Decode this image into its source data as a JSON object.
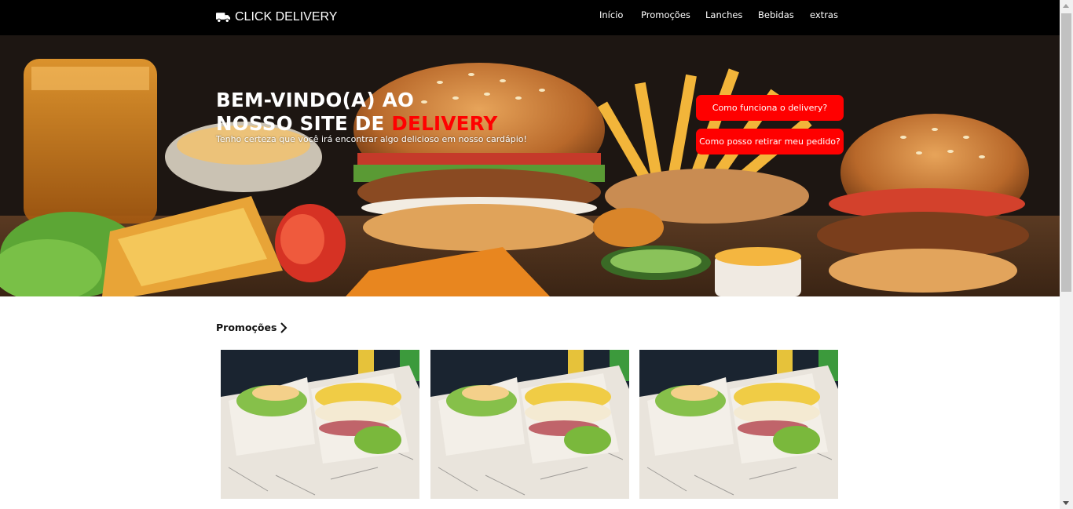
{
  "navbar": {
    "brand": "CLICK DELIVERY",
    "brand_icon": "truck-icon",
    "links": [
      "Início",
      "Promoções",
      "Lanches",
      "Bebidas",
      "extras"
    ]
  },
  "hero": {
    "title_line1": "BEM-VINDO(A) AO",
    "title_line2_prefix": "NOSSO SITE DE ",
    "title_line2_accent": "DELIVERY",
    "subtitle": "Tenho certeza que você irá encontrar algo delicioso em nosso cardápio!",
    "buttons": [
      "Como funciona o delivery?",
      "Como posso retirar meu pedido?"
    ]
  },
  "promotions": {
    "title": "Promoções",
    "title_icon": "chevron-right-icon",
    "cards": [
      {
        "image": "sandwich-combo-photo"
      },
      {
        "image": "sandwich-combo-photo"
      },
      {
        "image": "sandwich-combo-photo"
      }
    ]
  },
  "colors": {
    "accent": "#ff0000",
    "navbar": "#000000",
    "background": "#ffffff"
  }
}
